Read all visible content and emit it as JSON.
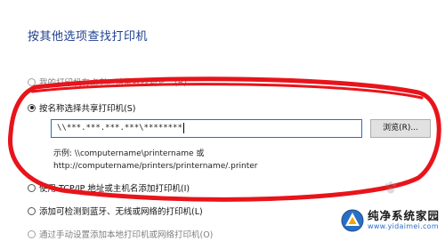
{
  "dialog": {
    "title": "按其他选项查找打印机"
  },
  "options": [
    {
      "label": "我的打印机有点老。请帮我找到它。(R)",
      "checked": false
    },
    {
      "label": "按名称选择共享打印机(S)",
      "checked": true
    },
    {
      "label": "使用 TCP/IP 地址或主机名添加打印机(I)",
      "checked": false
    },
    {
      "label": "添加可检测到蓝牙、无线或网络的打印机(L)",
      "checked": false
    },
    {
      "label": "通过手动设置添加本地打印机或网络打印机(O)",
      "checked": false
    }
  ],
  "shared_printer": {
    "input_value": "\\\\***.***.***.***\\********",
    "browse_label": "浏览(R)...",
    "example_line1": "示例: \\\\computername\\printername 或",
    "example_line2": "http://computername/printers/printername/.printer"
  },
  "annotation": {
    "color": "#e8141b"
  },
  "watermark": {
    "name": "纯净系统家园",
    "url": "www.yidaimei.com",
    "accent": "#2a6fc4"
  }
}
